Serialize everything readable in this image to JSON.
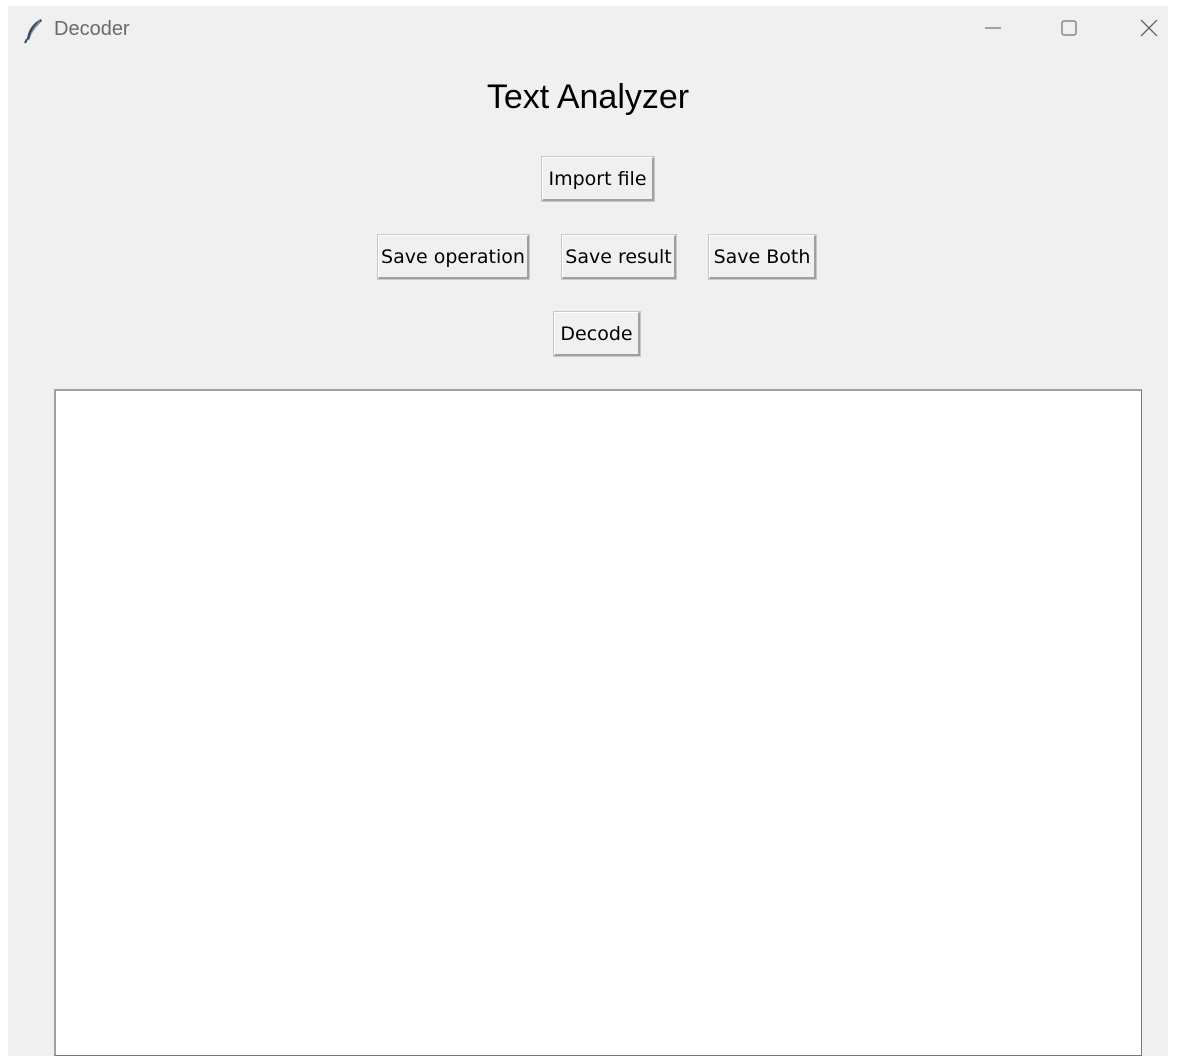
{
  "window": {
    "title": "Decoder",
    "icon": "feather-icon",
    "controls": {
      "minimize": "minimize-icon",
      "maximize": "maximize-icon",
      "close": "close-icon"
    }
  },
  "main": {
    "heading": "Text Analyzer",
    "buttons": {
      "import_file": "Import file",
      "save_operation": "Save operation",
      "save_result": "Save result",
      "save_both": "Save Both",
      "decode": "Decode"
    },
    "text_area": {
      "value": ""
    }
  }
}
